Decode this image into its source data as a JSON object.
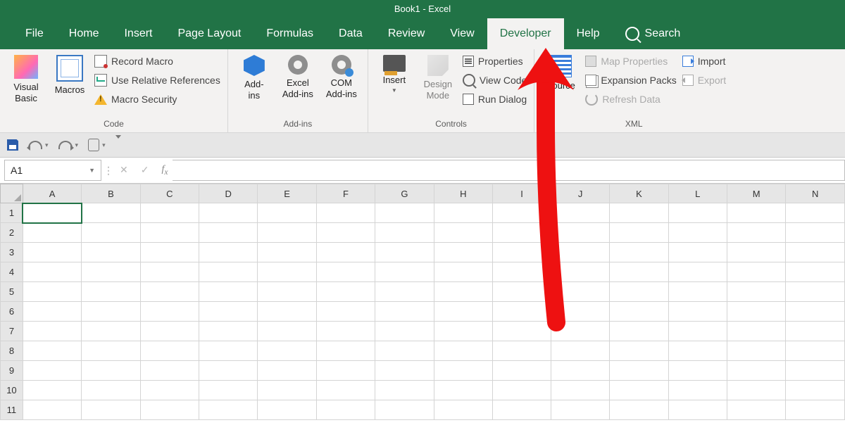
{
  "title": "Book1  -  Excel",
  "tabs": [
    "File",
    "Home",
    "Insert",
    "Page Layout",
    "Formulas",
    "Data",
    "Review",
    "View",
    "Developer",
    "Help",
    "Search"
  ],
  "active_tab": "Developer",
  "ribbon": {
    "code": {
      "visual_basic": "Visual\nBasic",
      "macros": "Macros",
      "record": "Record Macro",
      "relative": "Use Relative References",
      "security": "Macro Security",
      "label": "Code"
    },
    "addins": {
      "addins": "Add-\nins",
      "excel": "Excel\nAdd-ins",
      "com": "COM\nAdd-ins",
      "label": "Add-ins"
    },
    "controls": {
      "insert": "Insert",
      "design": "Design\nMode",
      "properties": "Properties",
      "viewcode": "View Code",
      "rundialog": "Run Dialog",
      "label": "Controls"
    },
    "xml": {
      "source": "Source",
      "mapprops": "Map Properties",
      "expansion": "Expansion Packs",
      "refresh": "Refresh Data",
      "import": "Import",
      "export": "Export",
      "label": "XML"
    }
  },
  "namebox": "A1",
  "formula": "",
  "columns": [
    "A",
    "B",
    "C",
    "D",
    "E",
    "F",
    "G",
    "H",
    "I",
    "J",
    "K",
    "L",
    "M",
    "N"
  ],
  "rows": [
    "1",
    "2",
    "3",
    "4",
    "5",
    "6",
    "7",
    "8",
    "9",
    "10",
    "11"
  ],
  "selected": "A1"
}
